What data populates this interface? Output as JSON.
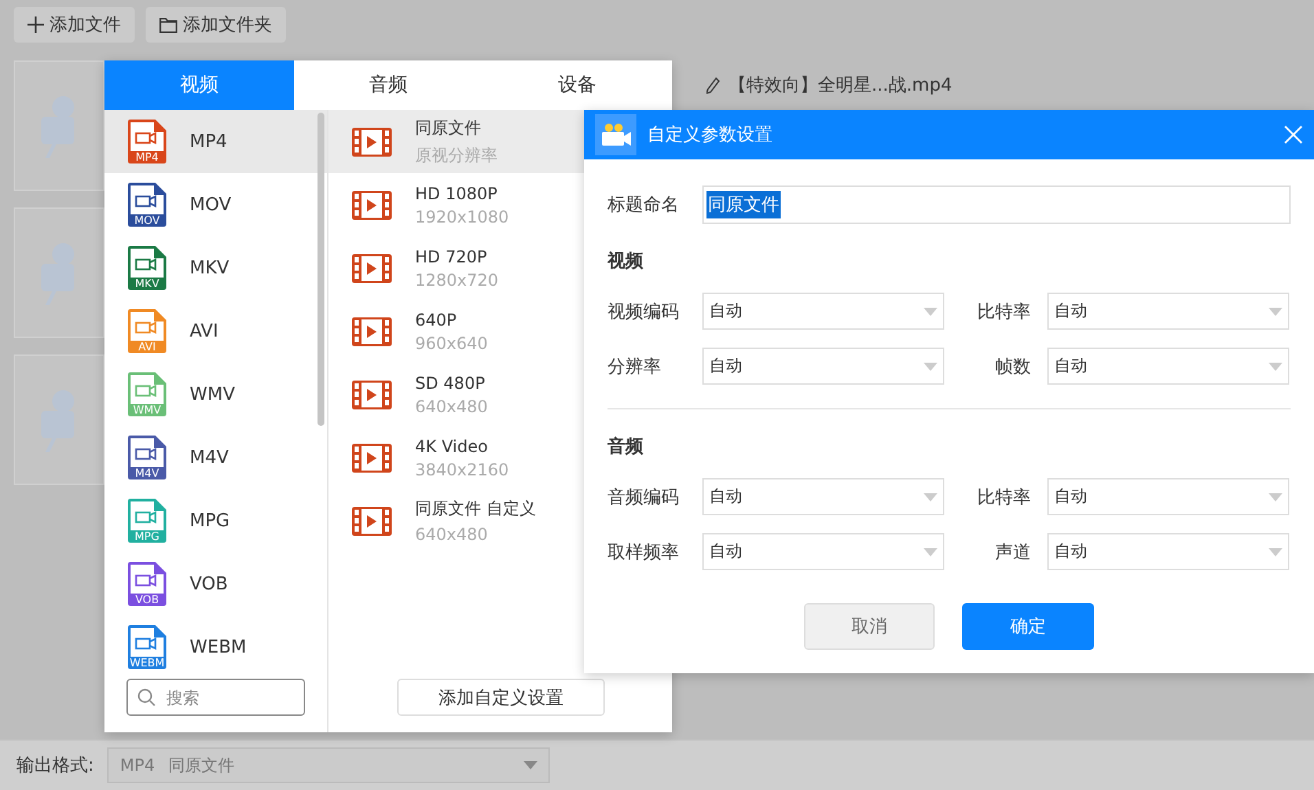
{
  "toolbar": {
    "buttons": [
      {
        "label": "添加文件",
        "kind": "plus"
      },
      {
        "label": "添加文件夹",
        "kind": "folder"
      }
    ]
  },
  "file_name": "【特效向】全明星...战.mp4",
  "format_popover": {
    "tabs": [
      {
        "label": "视频",
        "selected": true
      },
      {
        "label": "音频",
        "selected": false
      },
      {
        "label": "设备",
        "selected": false
      }
    ],
    "formats": [
      {
        "label": "MP4",
        "badge": "MP4",
        "color": "#d9461a",
        "selected": true
      },
      {
        "label": "MOV",
        "badge": "MOV",
        "color": "#2b4d9c",
        "selected": false
      },
      {
        "label": "MKV",
        "badge": "MKV",
        "color": "#1b7a45",
        "selected": false
      },
      {
        "label": "AVI",
        "badge": "AVI",
        "color": "#f08a24",
        "selected": false
      },
      {
        "label": "WMV",
        "badge": "WMV",
        "color": "#6abf77",
        "selected": false
      },
      {
        "label": "M4V",
        "badge": "M4V",
        "color": "#4a5aa8",
        "selected": false
      },
      {
        "label": "MPG",
        "badge": "MPG",
        "color": "#21b0a0",
        "selected": false
      },
      {
        "label": "VOB",
        "badge": "VOB",
        "color": "#7b4fe0",
        "selected": false
      },
      {
        "label": "WEBM",
        "badge": "WEBM",
        "color": "#1f7fe0",
        "selected": false
      }
    ],
    "presets": [
      {
        "name": "同原文件",
        "resolution": "原视分辨率",
        "selected": true
      },
      {
        "name": "HD 1080P",
        "resolution": "1920x1080",
        "selected": false
      },
      {
        "name": "HD 720P",
        "resolution": "1280x720",
        "selected": false
      },
      {
        "name": "640P",
        "resolution": "960x640",
        "selected": false
      },
      {
        "name": "SD 480P",
        "resolution": "640x480",
        "selected": false
      },
      {
        "name": "4K Video",
        "resolution": "3840x2160",
        "selected": false
      },
      {
        "name": "同原文件 自定义",
        "resolution": "640x480",
        "selected": false
      }
    ],
    "search": {
      "placeholder": "搜索"
    },
    "add_button": "添加自定义设置"
  },
  "dialog": {
    "title": "自定义参数设置",
    "name_label": "标题命名",
    "name_value": "同原文件",
    "sections": [
      {
        "title": "视频",
        "fields": [
          {
            "label": "视频编码",
            "value": "自动"
          },
          {
            "label": "比特率",
            "value": "自动"
          },
          {
            "label": "分辨率",
            "value": "自动"
          },
          {
            "label": "帧数",
            "value": "自动"
          }
        ]
      },
      {
        "title": "音频",
        "fields": [
          {
            "label": "音频编码",
            "value": "自动"
          },
          {
            "label": "比特率",
            "value": "自动"
          },
          {
            "label": "取样频率",
            "value": "自动"
          },
          {
            "label": "声道",
            "value": "自动"
          }
        ]
      }
    ],
    "cancel": "取消",
    "ok": "确定"
  },
  "output": {
    "label": "输出格式:",
    "format": "MP4",
    "preset": "同原文件"
  }
}
